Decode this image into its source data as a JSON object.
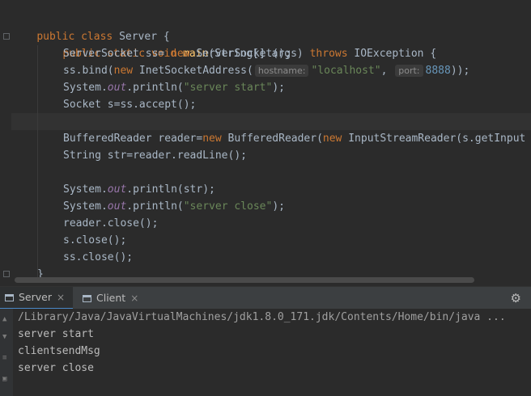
{
  "editor": {
    "lines": {
      "l1": [
        "public",
        "class",
        "Server",
        "{"
      ],
      "l2": [
        "public",
        "static",
        "void",
        "main",
        "(String[] args)",
        "throws",
        "IOException",
        "{"
      ],
      "l3": [
        "ServerSocket ss= ",
        "new",
        " ServerSocket();"
      ],
      "l4": [
        "ss.bind(",
        "new",
        " InetSocketAddress(",
        "hostname:",
        "\"localhost\"",
        ",",
        "port:",
        "8888",
        "));"
      ],
      "l5": [
        "System.",
        "out",
        ".println(",
        "\"server start\"",
        ");"
      ],
      "l6": [
        "Socket s=ss.accept();"
      ],
      "l8": [
        "BufferedReader reader=",
        "new",
        " BufferedReader(",
        "new",
        " InputStreamReader(s.getInput"
      ],
      "l9": [
        "String str=reader.readLine();"
      ],
      "l11": [
        "System.",
        "out",
        ".println(str);"
      ],
      "l12": [
        "System.",
        "out",
        ".println(",
        "\"server close\"",
        ");"
      ],
      "l13": [
        "reader.close();"
      ],
      "l14": [
        "s.close();"
      ],
      "l15": [
        "ss.close();"
      ],
      "l16": [
        "}"
      ]
    }
  },
  "run_panel": {
    "tabs": [
      {
        "label": "Server",
        "active": true
      },
      {
        "label": "Client",
        "active": false
      }
    ],
    "close_glyph": "×",
    "settings_glyph": "⚙"
  },
  "console": {
    "lines": [
      "/Library/Java/JavaVirtualMachines/jdk1.8.0_171.jdk/Contents/Home/bin/java ...",
      "server start",
      "clientsendMsg",
      "server close"
    ]
  },
  "colors": {
    "keyword": "#cc7832",
    "method": "#ffc66d",
    "string": "#6a8759",
    "number": "#6897bb",
    "static_field": "#9876aa",
    "text": "#a9b7c6",
    "background": "#2b2b2b",
    "tab_accent": "#4a88c7"
  }
}
